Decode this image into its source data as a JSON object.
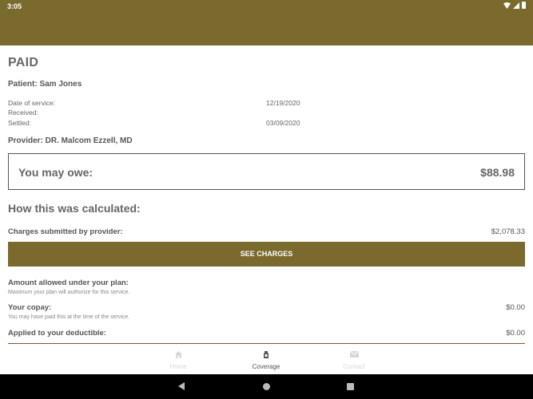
{
  "status_bar": {
    "time": "3:05"
  },
  "claim": {
    "status": "PAID",
    "patient": "Patient: Sam Jones",
    "dates": [
      {
        "label": "Date of service:",
        "value": "12/19/2020"
      },
      {
        "label": "Received:",
        "value": ""
      },
      {
        "label": "Settled:",
        "value": "03/09/2020"
      }
    ],
    "provider": "Provider: DR. Malcom Ezzell, MD"
  },
  "owe": {
    "label": "You may owe:",
    "amount": "$88.98"
  },
  "calculation": {
    "title": "How this was calculated:",
    "charges_label": "Charges submitted by provider:",
    "charges_value": "$2,078.33",
    "see_charges_label": "SEE CHARGES",
    "allowed_label": "Amount allowed under your plan:",
    "allowed_note": "Maximum your plan will authorize for this service.",
    "copay_label": "Your copay:",
    "copay_note": "You may have paid this at the time of the service.",
    "copay_value": "$0.00",
    "deductible_label": "Applied to your deductible:",
    "deductible_value": "$0.00"
  },
  "bottom_nav": {
    "items": [
      {
        "label": "Home",
        "icon": "home-icon",
        "active": false
      },
      {
        "label": "Coverage",
        "icon": "coverage-icon",
        "active": true
      },
      {
        "label": "Contact",
        "icon": "mail-icon",
        "active": false
      }
    ]
  },
  "colors": {
    "brand": "#7a6a2e",
    "text": "#555555",
    "inactive": "#d8d8d8"
  }
}
